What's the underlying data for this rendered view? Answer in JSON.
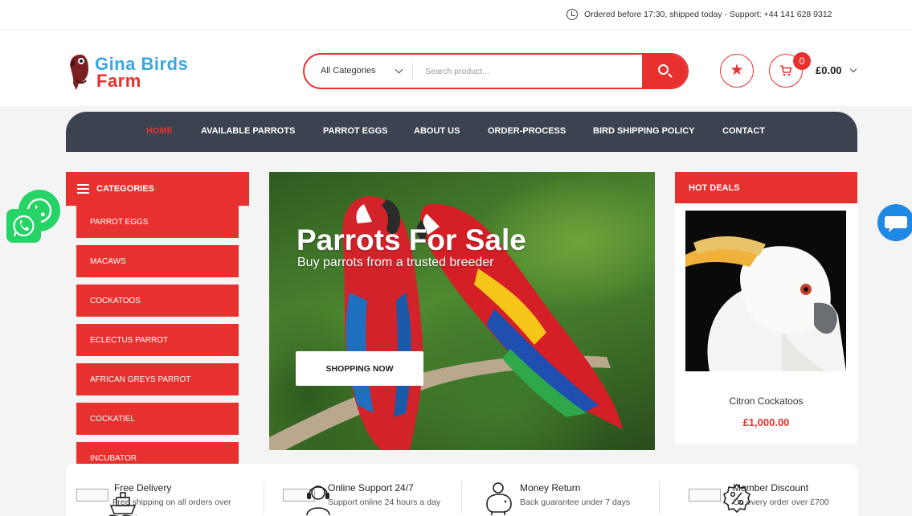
{
  "topbar": {
    "notice": "Ordered before 17:30, shipped today - Support: +44 141 628 9312"
  },
  "header": {
    "logo_line1": "Gina Birds",
    "logo_line2": "Farm",
    "search": {
      "category": "All Categories",
      "placeholder": "Search product..."
    },
    "cart": {
      "count": "0",
      "total": "£0.00"
    }
  },
  "nav": {
    "items": [
      "HOME",
      "AVAILABLE PARROTS",
      "PARROT EGGS",
      "ABOUT US",
      "ORDER-PROCESS",
      "BIRD SHIPPING POLICY",
      "CONTACT"
    ]
  },
  "sidebar": {
    "title": "CATEGORIES",
    "items": [
      "PARROT EGGS",
      "MACAWS",
      "COCKATOOS",
      "ECLECTUS PARROT",
      "AFRICAN GREYS PARROT",
      "COCKATIEL",
      "INCUBATOR"
    ]
  },
  "hero": {
    "title": "Parrots For Sale",
    "subtitle": "Buy parrots from a trusted breeder",
    "button": "SHOPPING NOW"
  },
  "deals": {
    "title": "HOT DEALS",
    "product_name": "Citron Cockatoos",
    "product_price": "£1,000.00"
  },
  "features": [
    {
      "title": "Free Delivery",
      "desc": "Free shipping on all orders over",
      "icon": "ship-icon"
    },
    {
      "title": "Online Support 24/7",
      "desc": "Support online 24 hours a day",
      "icon": "headset-icon"
    },
    {
      "title": "Money Return",
      "desc": "Back guarantee under 7 days",
      "icon": "piggy-bank-icon"
    },
    {
      "title": "Member Discount",
      "desc": "On every order over £700",
      "icon": "discount-icon"
    }
  ],
  "colors": {
    "accent": "#e8312e",
    "nav_bg": "#3c4350",
    "logo_blue": "#3aa6e0",
    "whatsapp": "#25d366",
    "chat": "#1e88e5"
  }
}
